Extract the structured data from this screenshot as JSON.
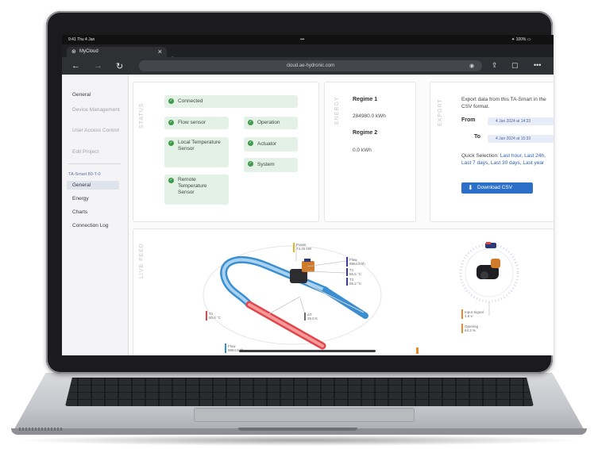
{
  "browser": {
    "status_time": "9:41  Thu 4 Jan",
    "status_center": "•••",
    "status_right": "✦ 100% ▭",
    "tab_title": "MyCloud",
    "url": "cloud.ae-hydronic.com"
  },
  "sidebar": {
    "items": [
      {
        "label": "General",
        "state": "normal"
      },
      {
        "label": "Device Management",
        "state": "disabled"
      },
      {
        "label": "User Access Control",
        "state": "disabled"
      },
      {
        "label": "Edit Project",
        "state": "disabled"
      }
    ],
    "device_name": "TA-Smart 80-T-0",
    "device_items": [
      {
        "label": "General",
        "active": true
      },
      {
        "label": "Energy"
      },
      {
        "label": "Charts"
      },
      {
        "label": "Connection Log"
      }
    ]
  },
  "status_panel": {
    "title": "STATUS",
    "items": [
      {
        "label": "Connected"
      },
      {
        "label": "Flow sensor"
      },
      {
        "label": "Operation"
      },
      {
        "label": "Local Temperature Sensor"
      },
      {
        "label": "Actuator"
      },
      {
        "label": "System"
      },
      {
        "label": "Remote Temperature Sensor"
      }
    ],
    "ok_color": "#3f9a4b"
  },
  "energy_panel": {
    "title": "ENERGY",
    "regimes": [
      {
        "name": "Regime 1",
        "value": "284980.0 kWh"
      },
      {
        "name": "Regime 2",
        "value": "0.0 kWh"
      }
    ]
  },
  "export_panel": {
    "title": "EXPORT",
    "description": "Export data from this TA-Smart in the CSV format.",
    "from_label": "From",
    "from_value": "4 Jan 2024 at 14:33",
    "to_label": "To",
    "to_value": "4 Jan 2024 at 15:33",
    "quick_label": "Quick Selection:",
    "quick_options": [
      "Last hour,",
      "Last 24h,",
      "Last 7 days,",
      "Last 30 days,",
      "Last year"
    ],
    "download_label": "Download CSV",
    "accent": "#2c6fc8"
  },
  "live_panel": {
    "title": "LIVE FEED",
    "tags": [
      {
        "name": "Power",
        "value": "74.25 kW",
        "color": "#e6b322"
      },
      {
        "name": "Flow",
        "value": "9864.8 l/h",
        "color": "#3b3f8f"
      },
      {
        "name": "T1",
        "value": "86.5 °C",
        "color": "#3b3f8f"
      },
      {
        "name": "T2",
        "value": "55.2 °C",
        "color": "#3b3f8f"
      },
      {
        "name": "T1",
        "value": "80.0 °C",
        "color": "#e0464a"
      },
      {
        "name": "ΔT",
        "value": "25.0 K",
        "color": "#6a6a70"
      },
      {
        "name": "Flow",
        "value": "9864.8 l/h",
        "color": "#3b8fd0"
      },
      {
        "name": "Input Signal",
        "value": "4.8 V",
        "color": "#e58a2a"
      },
      {
        "name": "Opening",
        "value": "64.3 %",
        "color": "#e58a2a"
      }
    ],
    "pipe_hot": "#e0464a",
    "pipe_cold": "#3b8fd0"
  }
}
